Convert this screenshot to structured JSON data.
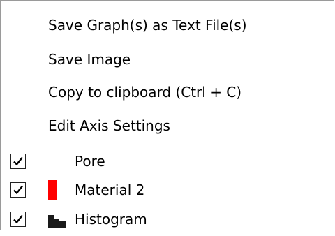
{
  "menu": {
    "items": [
      {
        "label": "Save Graph(s) as Text File(s)"
      },
      {
        "label": "Save Image"
      },
      {
        "label": "Copy to clipboard (Ctrl + C)"
      },
      {
        "label": "Edit Axis Settings"
      }
    ],
    "series": [
      {
        "label": "Pore",
        "checked": true,
        "legend": "none",
        "color": ""
      },
      {
        "label": "Material 2",
        "checked": true,
        "legend": "red-bar",
        "color": "#ff0000"
      },
      {
        "label": "Histogram",
        "checked": true,
        "legend": "histogram-icon",
        "color": "#1a1a1a"
      }
    ]
  }
}
